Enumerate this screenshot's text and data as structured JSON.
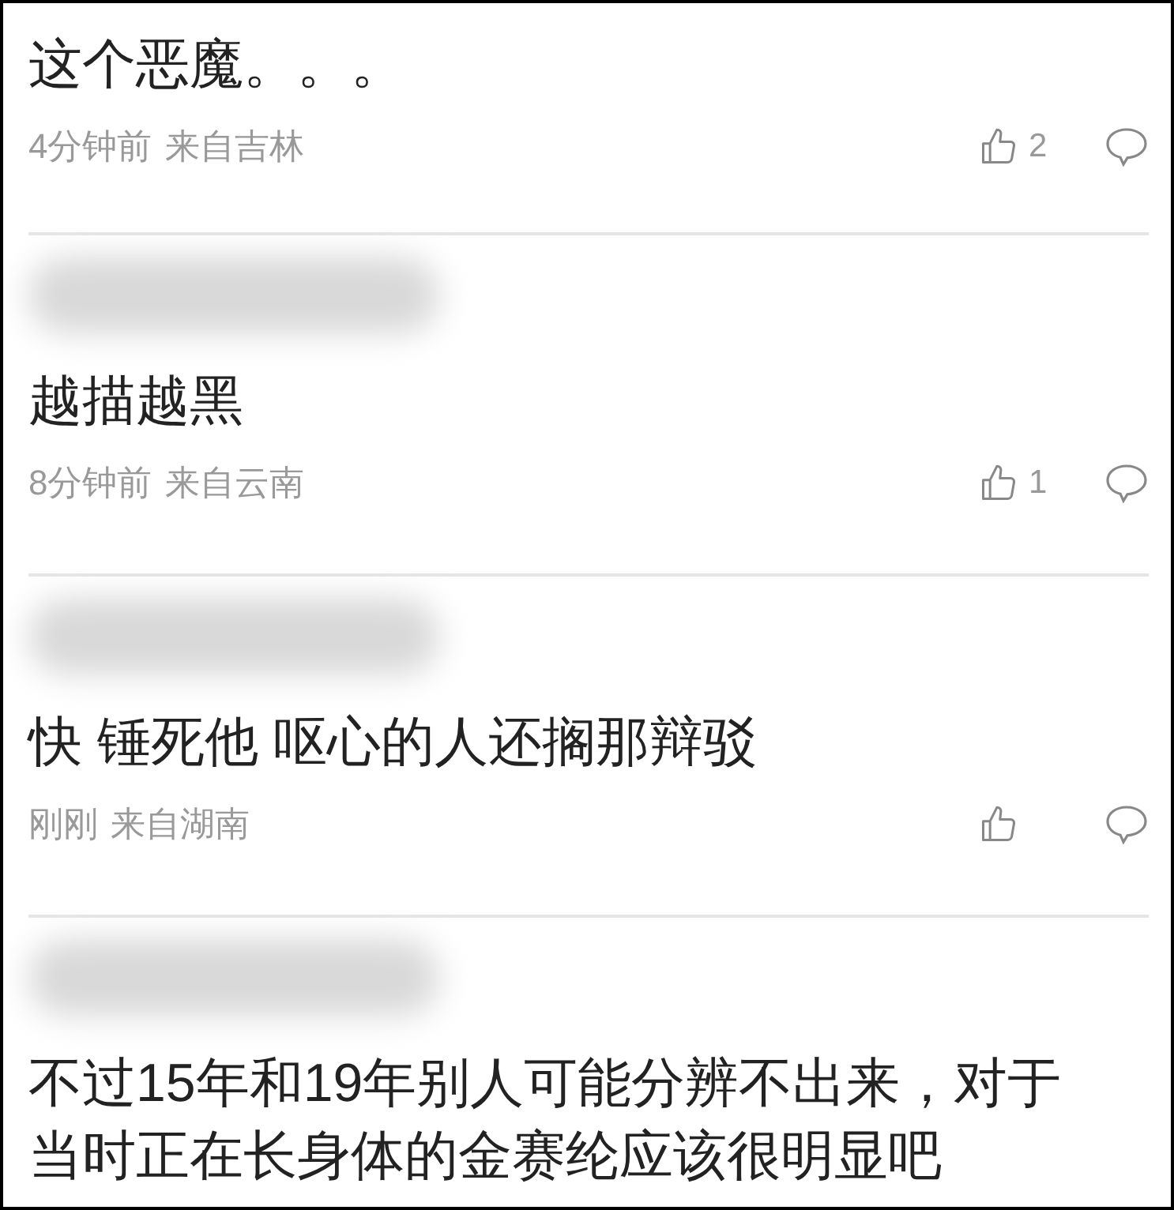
{
  "comments": [
    {
      "name_blurred": false,
      "text": "这个恶魔。。。",
      "time": "4分钟前",
      "location": "来自吉林",
      "likes": "2"
    },
    {
      "name_blurred": true,
      "text": "越描越黑",
      "time": "8分钟前",
      "location": "来自云南",
      "likes": "1"
    },
    {
      "name_blurred": true,
      "text": "快 锤死他 呕心的人还搁那辩驳",
      "time": "刚刚",
      "location": "来自湖南"
    },
    {
      "name_blurred": true,
      "text": "不过15年和19年别人可能分辨不出来，对于当时正在长身体的金赛纶应该很明显吧"
    }
  ]
}
